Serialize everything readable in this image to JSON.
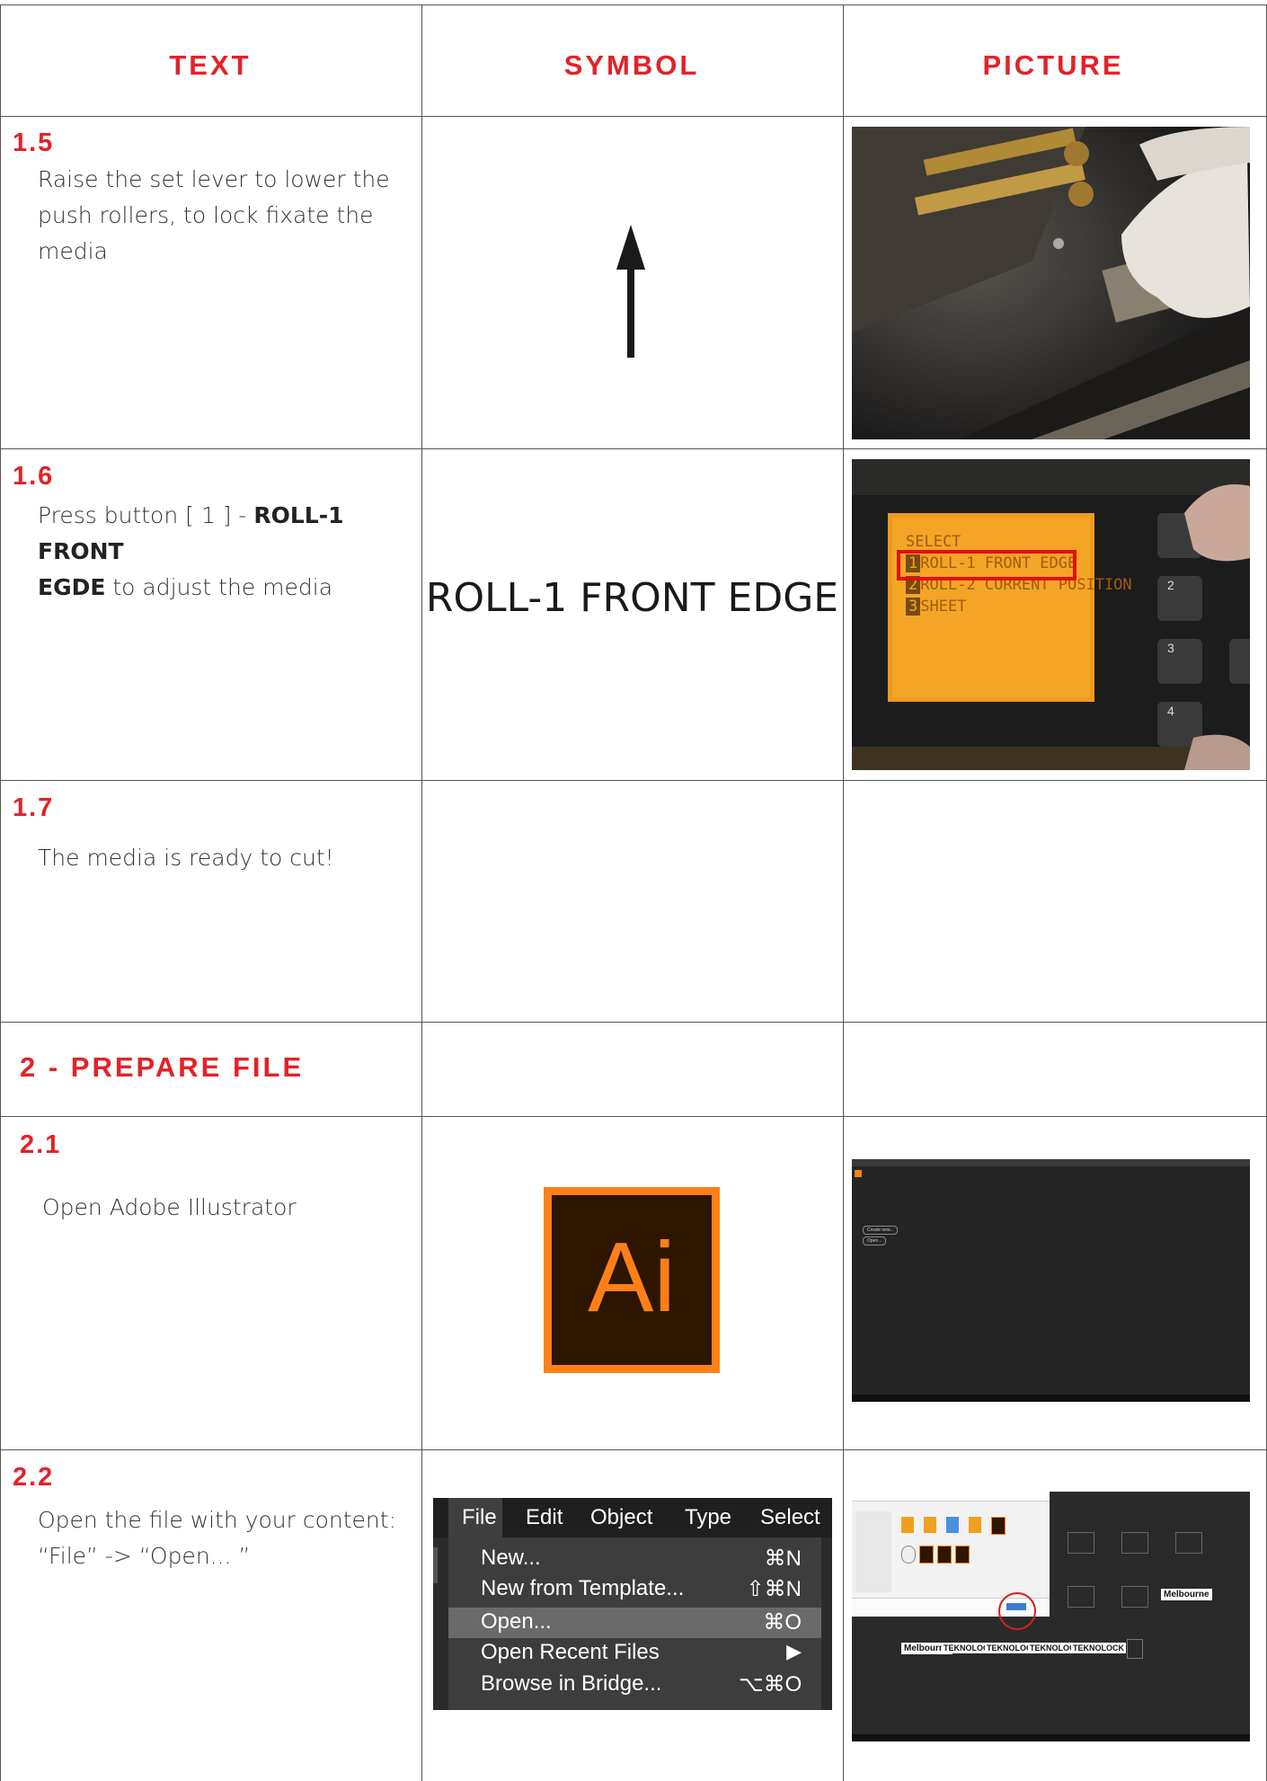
{
  "headers": {
    "text": "TEXT",
    "symbol": "SYMBOL",
    "picture": "PICTURE"
  },
  "rows": {
    "r15": {
      "num": "1.5",
      "text": "Raise the set lever to lower the push rollers, to lock fixate the media"
    },
    "r16": {
      "num": "1.6",
      "text_pre": "Press button [ 1 ] - ",
      "text_bold1": "ROLL-1 FRONT",
      "text_bold2": "EGDE",
      "text_post": " to adjust the media",
      "symbol": "ROLL-1 FRONT EDGE"
    },
    "r17": {
      "num": "1.7",
      "text": "The media is ready to cut!"
    },
    "section2": {
      "title": "2 - PREPARE FILE"
    },
    "r21": {
      "num": "2.1",
      "text": "Open Adobe Illustrator",
      "logo_text": "Ai"
    },
    "r22": {
      "num": "2.2",
      "text_line1": "Open the file with your content:",
      "text_line2": "“File” -> “Open... ”"
    }
  },
  "cutter_display": {
    "title": "SELECT",
    "options": [
      {
        "num": "1",
        "label": "ROLL-1 FRONT EDGE"
      },
      {
        "num": "2",
        "label": "ROLL-2 CURRENT POSITION"
      },
      {
        "num": "3",
        "label": "SHEET"
      }
    ],
    "keys": [
      "2",
      "3",
      "4"
    ]
  },
  "file_menu": {
    "menubar": [
      "File",
      "Edit",
      "Object",
      "Type",
      "Select"
    ],
    "items": [
      {
        "label": "New...",
        "shortcut": "⌘N"
      },
      {
        "label": "New from Template...",
        "shortcut": "⇧⌘N"
      },
      {
        "label": "Open...",
        "shortcut": "⌘O"
      },
      {
        "label": "Open Recent Files",
        "shortcut": "▶"
      },
      {
        "label": "Browse in Bridge...",
        "shortcut": "⌥⌘O"
      }
    ]
  },
  "illustrator_home": {
    "buttons": [
      "Create new...",
      "Open..."
    ]
  },
  "open_dialog": {
    "thumb_labels": [
      "Melbourne",
      "TEKNOLOCK",
      "TEKNOLOCK",
      "TEKNOLOCK",
      "TEKNOLOCK"
    ],
    "side_label": "Melbourne"
  },
  "colors": {
    "accent": "#e32228",
    "ai_orange": "#ff7f18",
    "ai_bg": "#2e1500",
    "lcd": "#f4a020"
  }
}
